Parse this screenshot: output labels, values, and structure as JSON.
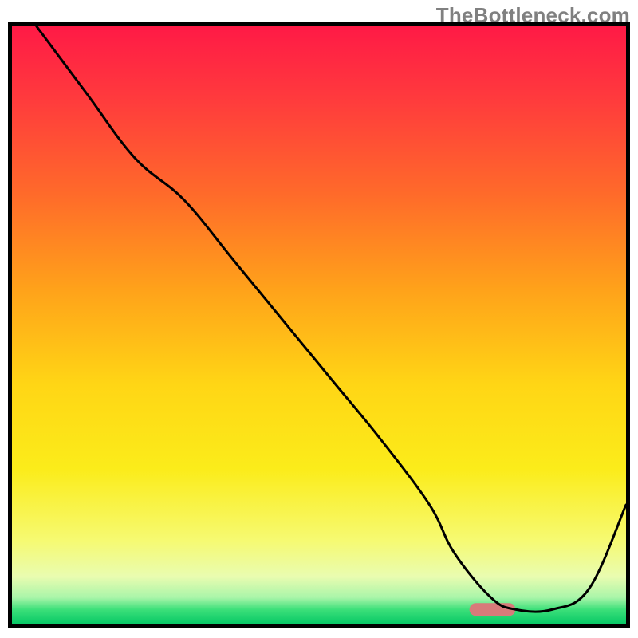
{
  "watermark": "TheBottleneck.com",
  "chart_data": {
    "type": "line",
    "title": "",
    "xlabel": "",
    "ylabel": "",
    "xlim": [
      0,
      100
    ],
    "ylim": [
      0,
      100
    ],
    "series": [
      {
        "name": "bottleneck-curve",
        "x": [
          4,
          12,
          20,
          28,
          36,
          44,
          52,
          60,
          68,
          72,
          78,
          82,
          88,
          94,
          100
        ],
        "y": [
          100,
          89,
          78,
          71,
          61,
          51,
          41,
          31,
          20,
          12,
          4.5,
          2.5,
          2.5,
          6,
          20
        ],
        "color_hex": "#000000",
        "stroke_width": 3
      }
    ],
    "marker": {
      "name": "optimal-range-bar",
      "x_start": 74.5,
      "x_end": 82,
      "y": 2.5,
      "color_hex": "#d87a7a",
      "thickness": 16,
      "rounded": true
    },
    "background_gradient": {
      "type": "vertical",
      "stops": [
        {
          "offset": 0.0,
          "color": "#ff1a46"
        },
        {
          "offset": 0.12,
          "color": "#ff3a3d"
        },
        {
          "offset": 0.28,
          "color": "#ff6a2a"
        },
        {
          "offset": 0.44,
          "color": "#ffa21a"
        },
        {
          "offset": 0.6,
          "color": "#ffd615"
        },
        {
          "offset": 0.74,
          "color": "#fbec1a"
        },
        {
          "offset": 0.86,
          "color": "#f6fa72"
        },
        {
          "offset": 0.92,
          "color": "#e9fcb0"
        },
        {
          "offset": 0.955,
          "color": "#a9f5a9"
        },
        {
          "offset": 0.975,
          "color": "#3de07a"
        },
        {
          "offset": 1.0,
          "color": "#05c765"
        }
      ]
    },
    "frame": {
      "border_color": "#000000",
      "border_width": 5
    }
  }
}
